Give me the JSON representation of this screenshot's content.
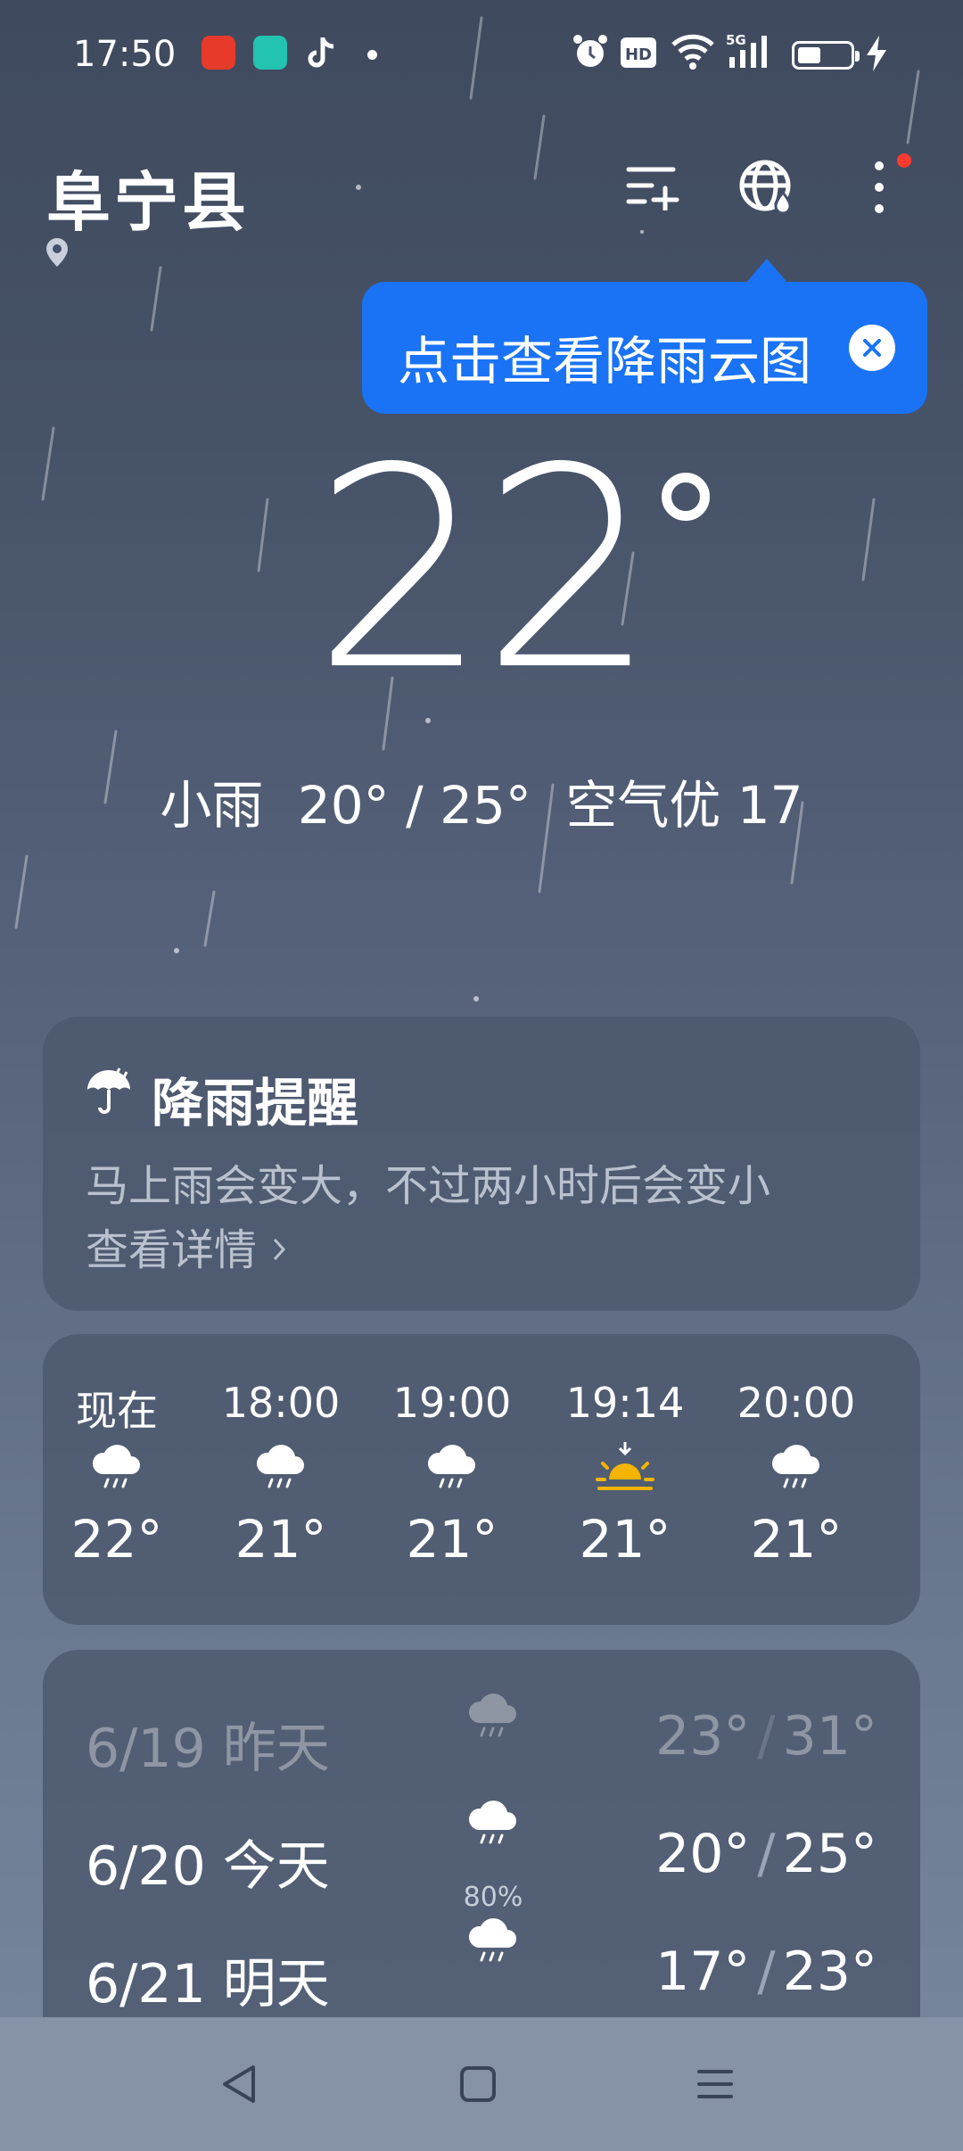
{
  "status_bar": {
    "time": "17:50",
    "apps": [
      "toutiao-app-icon",
      "green-app-icon",
      "tiktok-icon"
    ],
    "battery_level": 0.45,
    "icons": [
      "alarm-icon",
      "hd-icon",
      "wifi-icon",
      "5g-signal-icon",
      "battery-icon",
      "charging-icon"
    ]
  },
  "header": {
    "city": "阜宁县",
    "has_location_icon": true
  },
  "tooltip": {
    "text": "点击查看降雨云图"
  },
  "current": {
    "temperature": "22",
    "condition": "小雨",
    "range": "20° / 25°",
    "air_quality": "空气优 17"
  },
  "rain_alert": {
    "title": "降雨提醒",
    "description": "马上雨会变大，不过两小时后会变小",
    "link": "查看详情"
  },
  "hourly": [
    {
      "time": "现在",
      "icon": "rain-cloud-icon",
      "temp": "22°"
    },
    {
      "time": "18:00",
      "icon": "rain-cloud-icon",
      "temp": "21°"
    },
    {
      "time": "19:00",
      "icon": "rain-cloud-icon",
      "temp": "21°"
    },
    {
      "time": "19:14",
      "icon": "sunset-icon",
      "temp": "21°"
    },
    {
      "time": "20:00",
      "icon": "rain-cloud-icon",
      "temp": "21°"
    }
  ],
  "daily": [
    {
      "date": "6/19 昨天",
      "icon": "rain-cloud-icon",
      "precip": "",
      "low": "23°",
      "high": "31°"
    },
    {
      "date": "6/20 今天",
      "icon": "rain-cloud-icon",
      "precip": "80%",
      "low": "20°",
      "high": "25°"
    },
    {
      "date": "6/21 明天",
      "icon": "rain-cloud-icon",
      "precip": "",
      "low": "17°",
      "high": "23°"
    }
  ],
  "colors": {
    "tooltip_bg": "#1a73f5",
    "sunset": "#f5b400",
    "notification_dot": "#ff3b30"
  }
}
